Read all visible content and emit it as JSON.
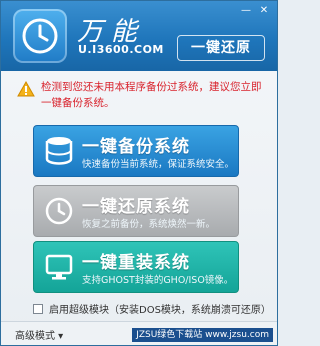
{
  "header": {
    "brand_name": "万能",
    "brand_url": "U.I3600.COM",
    "slogan": "一键还原"
  },
  "warning": {
    "text": "检测到您还未用本程序备份过系统，建议您立即一键备份系统。"
  },
  "buttons": {
    "backup": {
      "title": "一键备份系统",
      "subtitle": "快速备份当前系统，保证系统安全。"
    },
    "restore": {
      "title": "一键还原系统",
      "subtitle": "恢复之前备份，系统焕然一新。"
    },
    "reinstall": {
      "title": "一键重装系统",
      "subtitle": "支持GHOST封装的GHO/ISO镜像。"
    }
  },
  "checkbox": {
    "label": "启用超级模块（安装DOS模块，系统崩溃可还原）"
  },
  "footer": {
    "advanced_label": "高级模式 ▾",
    "watermark": "JZSU绿色下载站 www.jzsu.com"
  },
  "colors": {
    "header_blue": "#1f76bb",
    "warning_red": "#d9232d",
    "backup_blue": "#1a78c2",
    "restore_gray": "#a8abae",
    "reinstall_teal": "#14a498"
  }
}
